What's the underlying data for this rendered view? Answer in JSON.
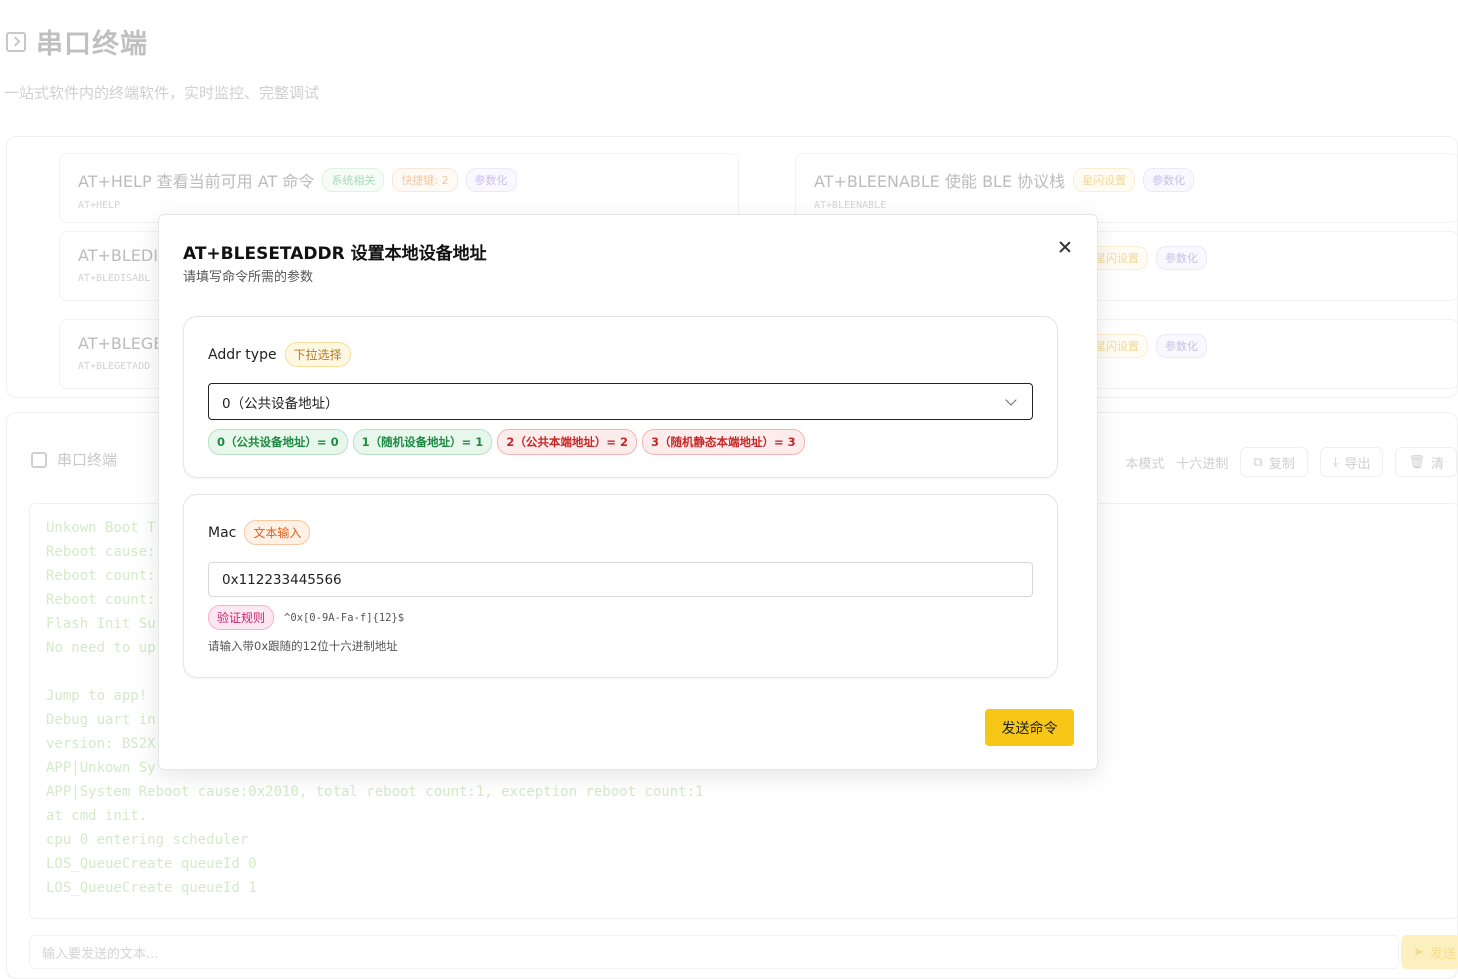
{
  "page": {
    "title": "串口终端",
    "subtitle": "一站式软件内的终端软件，实时监控、完整调试"
  },
  "commands": [
    {
      "title": "AT+HELP 查看当前可用 AT 命令",
      "code": "AT+HELP",
      "tags": [
        "系统相关",
        "快捷键: 2",
        "参数化"
      ]
    },
    {
      "title": "AT+BLEENABLE 使能 BLE 协议栈",
      "code": "AT+BLEENABLE",
      "tags": [
        "星闪设置",
        "参数化"
      ]
    },
    {
      "title": "AT+BLEDIS",
      "code": "AT+BLEDISABL",
      "tags": [
        "星闪设置",
        "参数化"
      ]
    },
    {
      "title": "AT+BLEGET",
      "code": "AT+BLEGETADD",
      "tags": [
        "星闪设置",
        "参数化"
      ]
    }
  ],
  "terminal": {
    "title": "串口终端",
    "tools": {
      "mode": "本模式",
      "hex": "十六进制",
      "copy": "复制",
      "export": "导出",
      "clear": "清"
    },
    "lines": [
      "Unkown Boot T",
      "Reboot cause:",
      "Reboot count:",
      "Reboot count:",
      "Flash Init Su",
      "No need to up",
      "",
      "Jump to app!",
      "Debug uart in",
      "version: BS2X",
      "APP|Unkown Sy",
      "APP|System Reboot cause:0x2010, total reboot count:1, exception reboot count:1",
      "at cmd init.",
      "cpu 0 entering scheduler",
      "LOS_QueueCreate queueId 0",
      "LOS_QueueCreate queueId 1"
    ],
    "input_placeholder": "输入要发送的文本...",
    "send_label": "发送"
  },
  "modal": {
    "title": "AT+BLESETADDR 设置本地设备地址",
    "subtitle": "请填写命令所需的参数",
    "fields": {
      "addr": {
        "label": "Addr type",
        "badge": "下拉选择",
        "selected": "0（公共设备地址）",
        "options": [
          "0（公共设备地址）= 0",
          "1（随机设备地址）= 1",
          "2（公共本端地址）= 2",
          "3（随机静态本端地址）= 3"
        ]
      },
      "mac": {
        "label": "Mac",
        "badge": "文本输入",
        "value": "0x112233445566",
        "rule_badge": "验证规则",
        "rule": "^0x[0-9A-Fa-f]{12}$",
        "hint": "请输入带0x跟随的12位十六进制地址"
      }
    },
    "submit_label": "发送命令"
  },
  "colors": {
    "accent": "#f7c717",
    "option_green": "#1f8a43",
    "option_red": "#c62828"
  }
}
